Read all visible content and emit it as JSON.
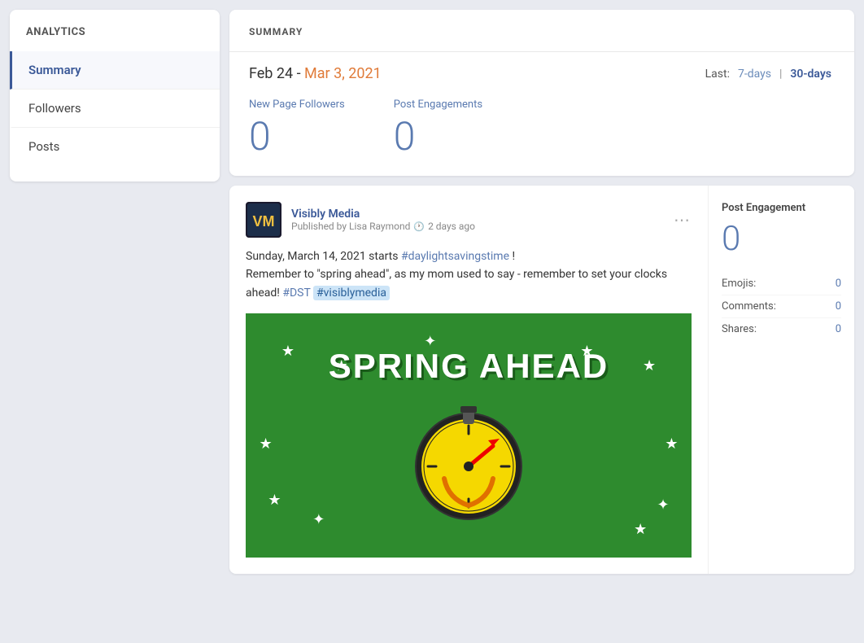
{
  "sidebar": {
    "title": "ANALYTICS",
    "items": [
      {
        "id": "summary",
        "label": "Summary",
        "active": true
      },
      {
        "id": "followers",
        "label": "Followers",
        "active": false
      },
      {
        "id": "posts",
        "label": "Posts",
        "active": false
      }
    ]
  },
  "summary": {
    "section_label": "SUMMARY",
    "date_range": {
      "start": "Feb 24 - ",
      "end": "Mar 3, 2021"
    },
    "last_label": "Last:",
    "btn_7days": "7-days",
    "btn_separator": "|",
    "btn_30days": "30-days",
    "metrics": [
      {
        "id": "new-page-followers",
        "label": "New Page Followers",
        "value": "0"
      },
      {
        "id": "post-engagements",
        "label": "Post Engagements",
        "value": "0"
      }
    ]
  },
  "post": {
    "author": {
      "initials": "VM",
      "name": "Visibly Media",
      "published_by": "Published by Lisa Raymond",
      "time_ago": "2 days ago"
    },
    "text_parts": [
      {
        "type": "normal",
        "text": "Sunday, March 14, 2021 starts "
      },
      {
        "type": "hashtag",
        "text": "#daylightsavingstime"
      },
      {
        "type": "normal",
        "text": " !\nRemember to \"spring ahead\", as my mom used to say - remember to set your clocks ahead! "
      },
      {
        "type": "hashtag",
        "text": "#DST"
      },
      {
        "type": "normal",
        "text": " "
      },
      {
        "type": "hashtag-highlight",
        "text": "#visiblymedia"
      }
    ],
    "image_text_line1": "SPRING AHEAD",
    "menu_icon": "⋯",
    "engagement": {
      "title": "Post Engagement",
      "value": "0",
      "rows": [
        {
          "label": "Emojis:",
          "count": "0"
        },
        {
          "label": "Comments:",
          "count": "0"
        },
        {
          "label": "Shares:",
          "count": "0"
        }
      ]
    }
  }
}
